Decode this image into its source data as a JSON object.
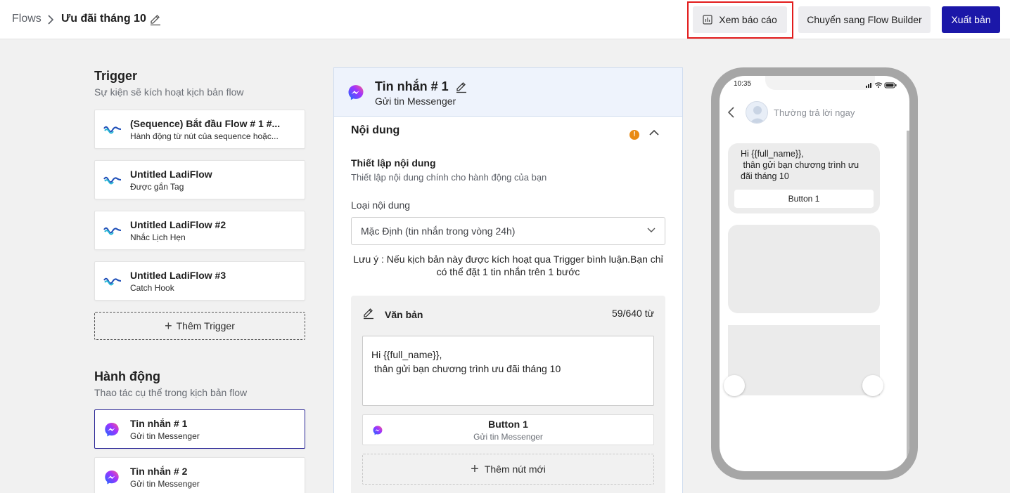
{
  "header": {
    "breadcrumb_root": "Flows",
    "flow_title": "Ưu đãi tháng 10",
    "report_label": "Xem báo cáo",
    "switch_label": "Chuyển sang Flow Builder",
    "publish_label": "Xuất bản"
  },
  "trigger": {
    "title": "Trigger",
    "subtitle": "Sự kiện sẽ kích hoạt kịch bản flow",
    "items": [
      {
        "title": "(Sequence) Bắt đầu Flow # 1 #...",
        "subtitle": "Hành động từ nút của sequence hoặc..."
      },
      {
        "title": "Untitled LadiFlow",
        "subtitle": "Được gắn Tag"
      },
      {
        "title": "Untitled LadiFlow #2",
        "subtitle": "Nhắc Lịch Hẹn"
      },
      {
        "title": "Untitled LadiFlow #3",
        "subtitle": "Catch Hook"
      }
    ],
    "add_label": "Thêm Trigger"
  },
  "actions": {
    "title": "Hành động",
    "subtitle": "Thao tác cụ thể trong kịch bản flow",
    "items": [
      {
        "title": "Tin nhắn # 1",
        "subtitle": "Gửi tin Messenger",
        "selected": true
      },
      {
        "title": "Tin nhắn # 2",
        "subtitle": "Gửi tin Messenger",
        "selected": false
      }
    ]
  },
  "editor": {
    "title": "Tin nhắn # 1",
    "subtitle": "Gửi tin Messenger",
    "section_title": "Nội dung",
    "warning_badge": "!",
    "setup_title": "Thiết lập nội dung",
    "setup_subtitle": "Thiết lập nội dung chính cho hành động của bạn",
    "content_type_label": "Loại nội dung",
    "content_type_value": "Mặc Định (tin nhắn trong vòng 24h)",
    "note": "Lưu ý : Nếu kịch bản này được kích hoạt qua Trigger bình luận.Bạn chỉ có thể đặt 1 tin nhắn trên 1 bước",
    "text_block_label": "Văn bản",
    "word_count": "59/640 từ",
    "message_text": "Hi {{full_name}},\n thân gửi bạn chương trình ưu đãi tháng 10",
    "button": {
      "title": "Button 1",
      "subtitle": "Gửi tin Messenger"
    },
    "add_button_label": "Thêm nút mới"
  },
  "preview": {
    "time": "10:35",
    "reply_status": "Thường trả lời ngay",
    "bubble_text": "Hi {{full_name}},\n thân gửi bạn chương trình ưu\nđãi tháng 10",
    "bubble_button": "Button 1"
  },
  "colors": {
    "primary": "#1b17a8",
    "highlight": "#e21b1b",
    "warning": "#e98a12",
    "panel_header": "#eef3fc"
  },
  "icons": {
    "ladiflow": "ladiflow-wave-icon",
    "messenger": "messenger-icon",
    "edit": "pencil-icon",
    "report": "bar-chart-icon"
  }
}
